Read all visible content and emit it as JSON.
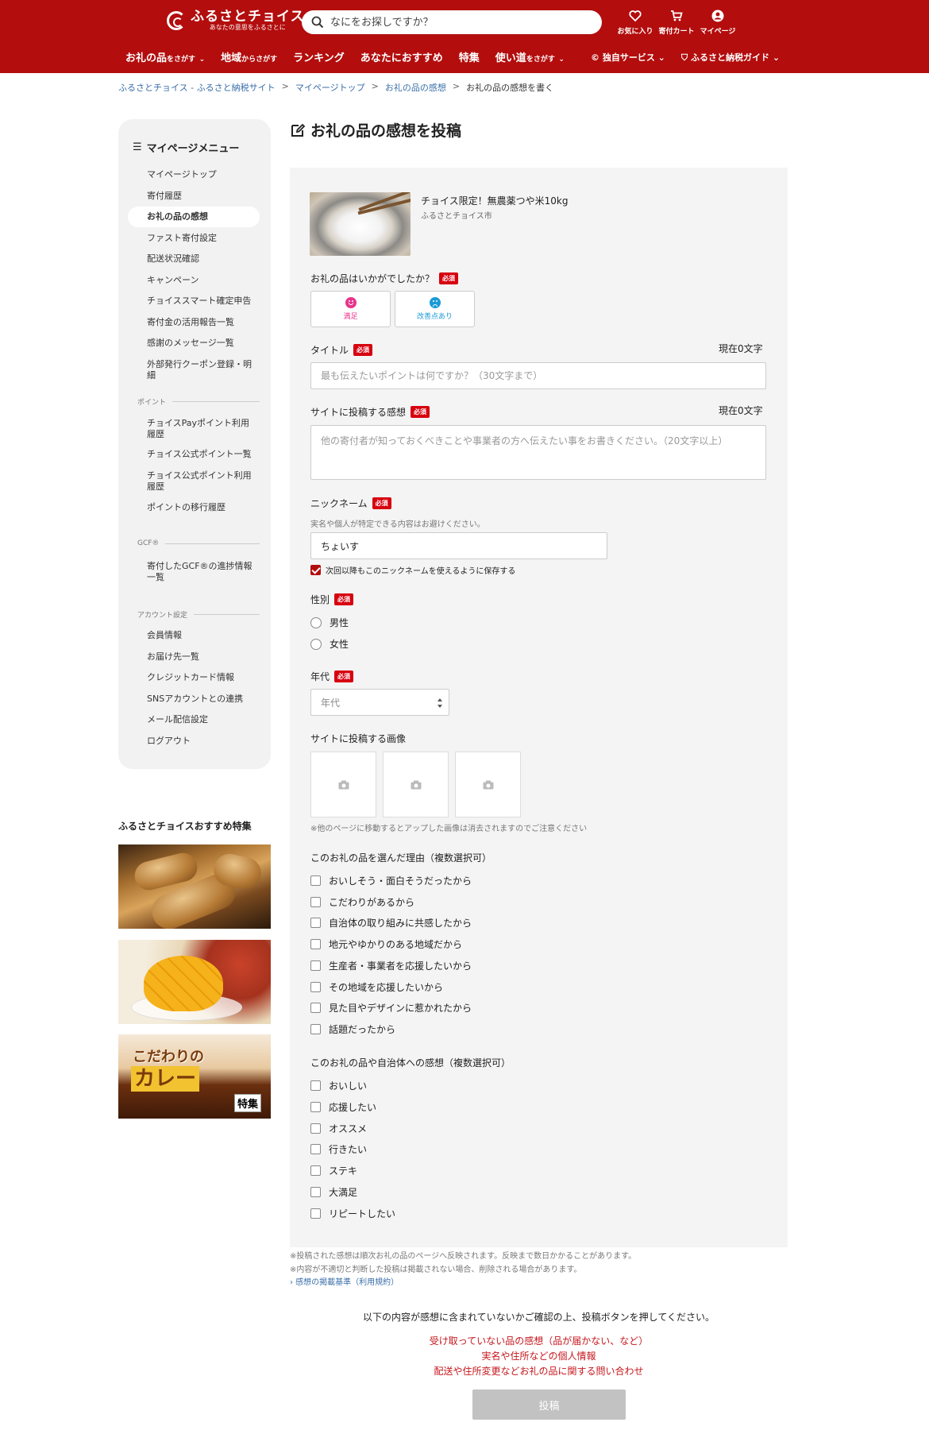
{
  "header": {
    "logo_name": "ふるさとチョイス",
    "logo_tag": "あなたの意思をふるさとに",
    "search_placeholder": "なにをお探しですか？",
    "icons": [
      {
        "label": "お気に入り",
        "icon": "heart-icon"
      },
      {
        "label": "寄付カート",
        "icon": "cart-icon"
      },
      {
        "label": "マイページ",
        "icon": "user-icon"
      }
    ],
    "nav": [
      {
        "main": "お礼の品",
        "sub": "をさがす",
        "arrow": "⌄"
      },
      {
        "main": "地域",
        "sub": "からさがす",
        "arrow": ""
      },
      {
        "main": "ランキング",
        "sub": "",
        "arrow": ""
      },
      {
        "main": "あなたにおすすめ",
        "sub": "",
        "arrow": ""
      },
      {
        "main": "特集",
        "sub": "",
        "arrow": ""
      },
      {
        "main": "使い道",
        "sub": "をさがす",
        "arrow": "⌄"
      }
    ],
    "nav_right": [
      {
        "label": "独自サービス",
        "icon": "choice-logo-icon"
      },
      {
        "label": "ふるさと納税ガイド",
        "icon": "shield-icon"
      }
    ],
    "colors": {
      "brand": "#b30d0d"
    }
  },
  "breadcrumb": [
    "ふるさとチョイス - ふるさと納税サイト",
    "マイページトップ",
    "お礼の品の感想",
    "お礼の品の感想を書く"
  ],
  "sidebar": {
    "title": "マイページメニュー",
    "items": [
      "マイページトップ",
      "寄付履歴",
      "お礼の品の感想",
      "ファスト寄付設定",
      "配送状況確認",
      "キャンペーン",
      "チョイススマート確定申告",
      "寄付金の活用報告一覧",
      "感謝のメッセージ一覧",
      "外部発行クーポン登録・明細"
    ],
    "active_index": 2,
    "groups": {
      "point": {
        "label": "ポイント",
        "items": [
          "チョイスPayポイント利用履歴",
          "チョイス公式ポイント一覧",
          "チョイス公式ポイント利用履歴",
          "ポイントの移行履歴"
        ]
      },
      "gcf": {
        "label": "GCF®",
        "items": [
          "寄付したGCF®の進捗情報一覧"
        ]
      },
      "account": {
        "label": "アカウント設定",
        "items": [
          "会員情報",
          "お届け先一覧",
          "クレジットカード情報",
          "SNSアカウントとの連携",
          "メール配信設定",
          "ログアウト"
        ]
      }
    }
  },
  "recommend": {
    "title": "ふるさとチョイスおすすめ特集",
    "curry_line1": "こだわりの",
    "curry_line2": "カレー",
    "curry_badge": "特集"
  },
  "main": {
    "title": "お礼の品の感想を投稿",
    "product": {
      "name": "チョイス限定！無農薬つや米10kg",
      "city": "ふるさとチョイス市"
    },
    "required_label": "必須",
    "rating": {
      "label": "お礼の品はいかがでしたか？",
      "good": "満足",
      "bad": "改善点あり"
    },
    "title_field": {
      "label": "タイトル",
      "counter": "現在0文字",
      "placeholder": "最も伝えたいポイントは何ですか？（30文字まで）"
    },
    "review_field": {
      "label": "サイトに投稿する感想",
      "counter": "現在0文字",
      "placeholder": "他の寄付者が知っておくべきことや事業者の方へ伝えたい事をお書きください。（20文字以上）"
    },
    "nickname": {
      "label": "ニックネーム",
      "note": "実名や個人が特定できる内容はお避けください。",
      "value": "ちょいす",
      "save_label": "次回以降もこのニックネームを使えるように保存する",
      "save_checked": true
    },
    "gender": {
      "label": "性別",
      "options": [
        "男性",
        "女性"
      ]
    },
    "age": {
      "label": "年代",
      "selected": "年代"
    },
    "images": {
      "label": "サイトに投稿する画像",
      "note": "※他のページに移動するとアップした画像は消去されますのでご注意ください"
    },
    "reasons": {
      "label": "このお礼の品を選んだ理由（複数選択可）",
      "options": [
        "おいしそう・面白そうだったから",
        "こだわりがあるから",
        "自治体の取り組みに共感したから",
        "地元やゆかりのある地域だから",
        "生産者・事業者を応援したいから",
        "その地域を応援したいから",
        "見た目やデザインに惹かれたから",
        "話題だったから"
      ]
    },
    "impressions": {
      "label": "このお礼の品や自治体への感想（複数選択可）",
      "options": [
        "おいしい",
        "応援したい",
        "オススメ",
        "行きたい",
        "ステキ",
        "大満足",
        "リピートしたい"
      ]
    }
  },
  "footer": {
    "note1": "※投稿された感想は順次お礼の品のページへ反映されます。反映まで数日かかることがあります。",
    "note2": "※内容が不適切と判断した投稿は掲載されない場合、削除される場合があります。",
    "link": "› 感想の掲載基準（利用規約）",
    "confirm": "以下の内容が感想に含まれていないかご確認の上、投稿ボタンを押してください。",
    "warnings": [
      "受け取っていない品の感想（品が届かない、など）",
      "実名や住所などの個人情報",
      "配送や住所変更などお礼の品に関する問い合わせ"
    ],
    "submit": "投稿"
  }
}
